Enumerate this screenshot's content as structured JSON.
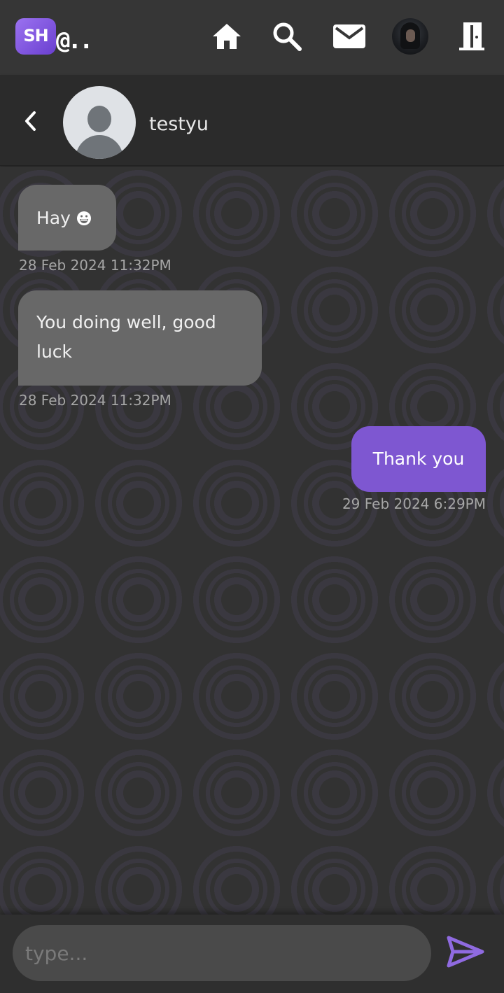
{
  "app": {
    "logo_text": "SH",
    "logo_suffix": "@.."
  },
  "nav": {
    "items": [
      {
        "icon": "home-icon"
      },
      {
        "icon": "search-icon"
      },
      {
        "icon": "mail-icon"
      },
      {
        "icon": "user-avatar"
      },
      {
        "icon": "logout-door-icon"
      }
    ]
  },
  "chat": {
    "contact_name": "testyu",
    "messages": [
      {
        "direction": "incoming",
        "text": "Hay",
        "emoji": "grinning-face-icon",
        "timestamp": "28 Feb 2024 11:32PM"
      },
      {
        "direction": "incoming",
        "text": "You doing well, good luck",
        "timestamp": "28 Feb 2024 11:32PM"
      },
      {
        "direction": "outgoing",
        "text": "Thank you",
        "timestamp": "29 Feb 2024 6:29PM"
      }
    ]
  },
  "composer": {
    "value": "",
    "placeholder": "type..."
  },
  "colors": {
    "accent": "#7e57d1",
    "incoming_bubble": "#686868",
    "background": "#333333"
  }
}
